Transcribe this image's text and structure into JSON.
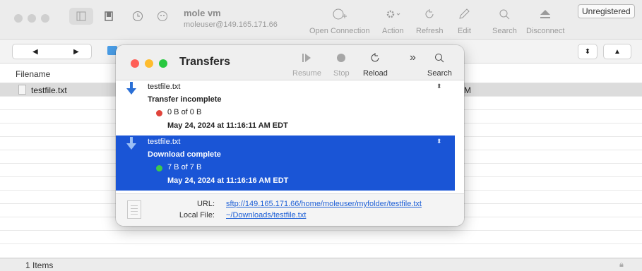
{
  "window": {
    "title": "mole vm",
    "subtitle": "moleuser@149.165.171.66",
    "unregistered_label": "Unregistered"
  },
  "toolbar": {
    "items": [
      {
        "label": "Open Connection",
        "icon": "open-connection-icon"
      },
      {
        "label": "Action",
        "icon": "gear-icon"
      },
      {
        "label": "Refresh",
        "icon": "refresh-icon"
      },
      {
        "label": "Edit",
        "icon": "pencil-icon"
      },
      {
        "label": "Search",
        "icon": "search-icon"
      },
      {
        "label": "Disconnect",
        "icon": "eject-icon"
      }
    ]
  },
  "browser": {
    "column_filename": "Filename",
    "files": [
      {
        "name": "testfile.txt",
        "peek": "M"
      }
    ],
    "status_count": "1 Items"
  },
  "transfers": {
    "title": "Transfers",
    "toolbar": {
      "resume": "Resume",
      "stop": "Stop",
      "reload": "Reload",
      "search": "Search"
    },
    "items": [
      {
        "filename": "testfile.txt",
        "status": "Transfer incomplete",
        "bytes": "0 B of 0 B",
        "date": "May 24, 2024 at 11:16:11 AM EDT",
        "dot_color": "#e0443b",
        "selected": false
      },
      {
        "filename": "testfile.txt",
        "status": "Download complete",
        "bytes": "7 B of 7 B",
        "date": "May 24, 2024 at 11:16:16 AM EDT",
        "dot_color": "#3ec94a",
        "selected": true
      }
    ],
    "footer": {
      "url_label": "URL:",
      "url_value": "sftp://149.165.171.66/home/moleuser/myfolder/testfile.txt",
      "local_label": "Local File:",
      "local_value": "~/Downloads/testfile.txt"
    }
  },
  "colors": {
    "selection_blue": "#1a55d6",
    "link_blue": "#1d5fd6",
    "close_red": "#ff5f57",
    "minimize_yellow": "#febc2e",
    "zoom_green": "#28c840"
  }
}
